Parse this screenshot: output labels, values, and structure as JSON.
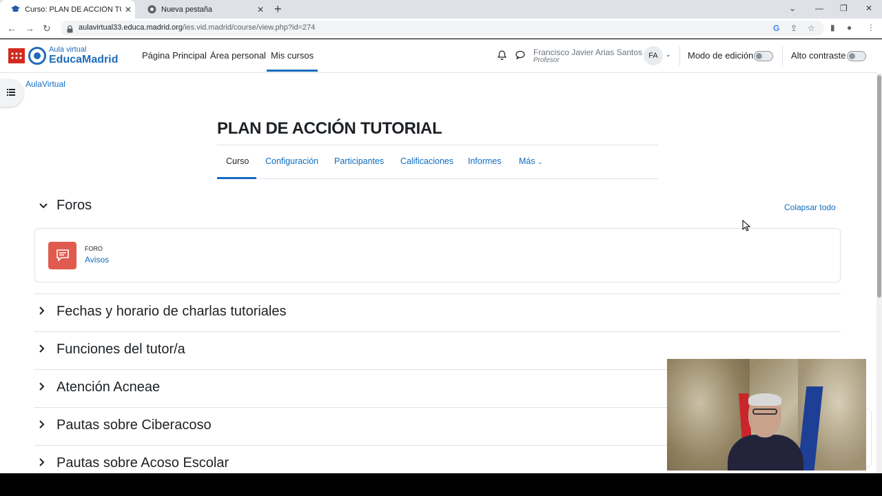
{
  "browser": {
    "tabs": [
      {
        "title": "Curso: PLAN DE ACCIÓN TUTORI",
        "active": true
      },
      {
        "title": "Nueva pestaña",
        "active": false
      }
    ],
    "url_host": "aulavirtual33.educa.madrid.org",
    "url_path": "/ies.vid.madrid/course/view.php?id=274"
  },
  "header": {
    "logo_small": "Aula virtual",
    "logo_big": "EducaMadrid",
    "menu": [
      "Página Principal",
      "Área personal",
      "Mis cursos"
    ],
    "active_menu": "Mis cursos",
    "user_name": "Francisco Javier Arias Santos",
    "user_role": "Profesor",
    "avatar_initials": "FA",
    "edit_mode_label": "Modo de edición",
    "edit_mode_on": false,
    "high_contrast_label": "Alto contraste",
    "high_contrast_on": false
  },
  "breadcrumb": "AulaVirtual",
  "course": {
    "title": "PLAN DE ACCIÓN TUTORIAL",
    "tabs": [
      "Curso",
      "Configuración",
      "Participantes",
      "Calificaciones",
      "Informes",
      "Más"
    ],
    "active_tab": "Curso"
  },
  "collapse_all": "Colapsar todo",
  "sections": [
    {
      "name": "Foros",
      "expanded": true
    },
    {
      "name": "Fechas y horario de charlas tutoriales",
      "expanded": false
    },
    {
      "name": "Funciones del tutor/a",
      "expanded": false
    },
    {
      "name": "Atención Acneae",
      "expanded": false
    },
    {
      "name": "Pautas sobre Ciberacoso",
      "expanded": false
    },
    {
      "name": "Pautas sobre Acoso Escolar",
      "expanded": false
    }
  ],
  "activity": {
    "type": "FORO",
    "name": "Avisos",
    "icon": "forum-icon",
    "color": "#e05a4d"
  },
  "colors": {
    "link": "#0f6cbf",
    "text": "#1d2125",
    "border": "#dee2e6"
  }
}
